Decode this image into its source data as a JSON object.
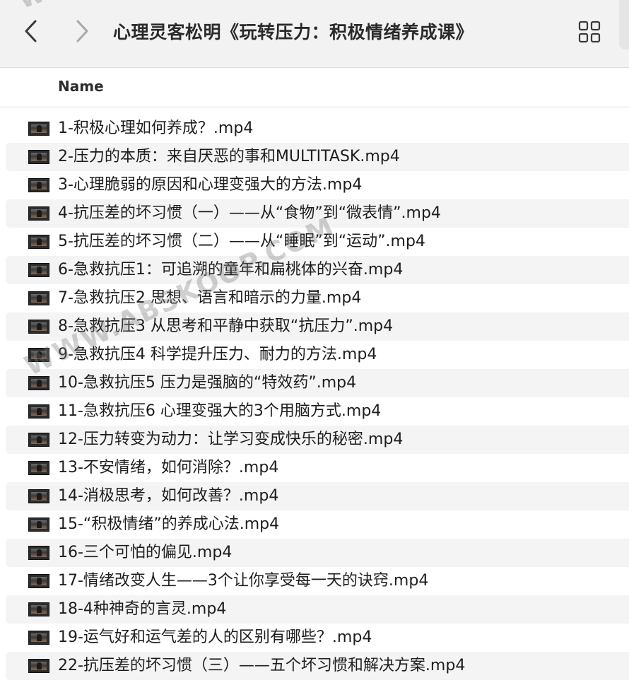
{
  "toolbar": {
    "title": "心理灵客松明《玩转压力：积极情绪养成课》",
    "back_icon": "chevron-left-icon",
    "forward_icon": "chevron-right-icon",
    "view_icon": "grid-view-icon"
  },
  "columns": {
    "name": "Name"
  },
  "files": [
    "1-积极心理如何养成？.mp4",
    "2-压力的本质：来自厌恶的事和MULTITASK.mp4",
    "3-心理脆弱的原因和心理变强大的方法.mp4",
    "4-抗压差的坏习惯（一）——从“食物”到“微表情”.mp4",
    "5-抗压差的坏习惯（二）——从“睡眠”到“运动”.mp4",
    "6-急救抗压1：可追溯的童年和扁桃体的兴奋.mp4",
    "7-急救抗压2 思想、语言和暗示的力量.mp4",
    "8-急救抗压3 从思考和平静中获取“抗压力”.mp4",
    "9-急救抗压4 科学提升压力、耐力的方法.mp4",
    "10-急救抗压5 压力是强脑的“特效药”.mp4",
    "11-急救抗压6 心理变强大的3个用脑方式.mp4",
    "12-压力转变为动力：让学习变成快乐的秘密.mp4",
    "13-不安情绪，如何消除？.mp4",
    "14-消极思考，如何改善？.mp4",
    "15-“积极情绪”的养成心法.mp4",
    "16-三个可怕的偏见.mp4",
    "17-情绪改变人生——3个让你享受每一天的诀窍.mp4",
    "18-4种神奇的言灵.mp4",
    "19-运气好和运气差的人的区别有哪些？.mp4",
    "22-抗压差的坏习惯（三）——五个坏习惯和解决方案.mp4"
  ],
  "watermark": {
    "top": "WW",
    "middle": "WWW.ABSKOOP.COM"
  },
  "colors": {
    "toolbar_bg": "#f3f2f3",
    "alt_row_bg": "#f4f4f5",
    "text": "#1d1d1f"
  }
}
